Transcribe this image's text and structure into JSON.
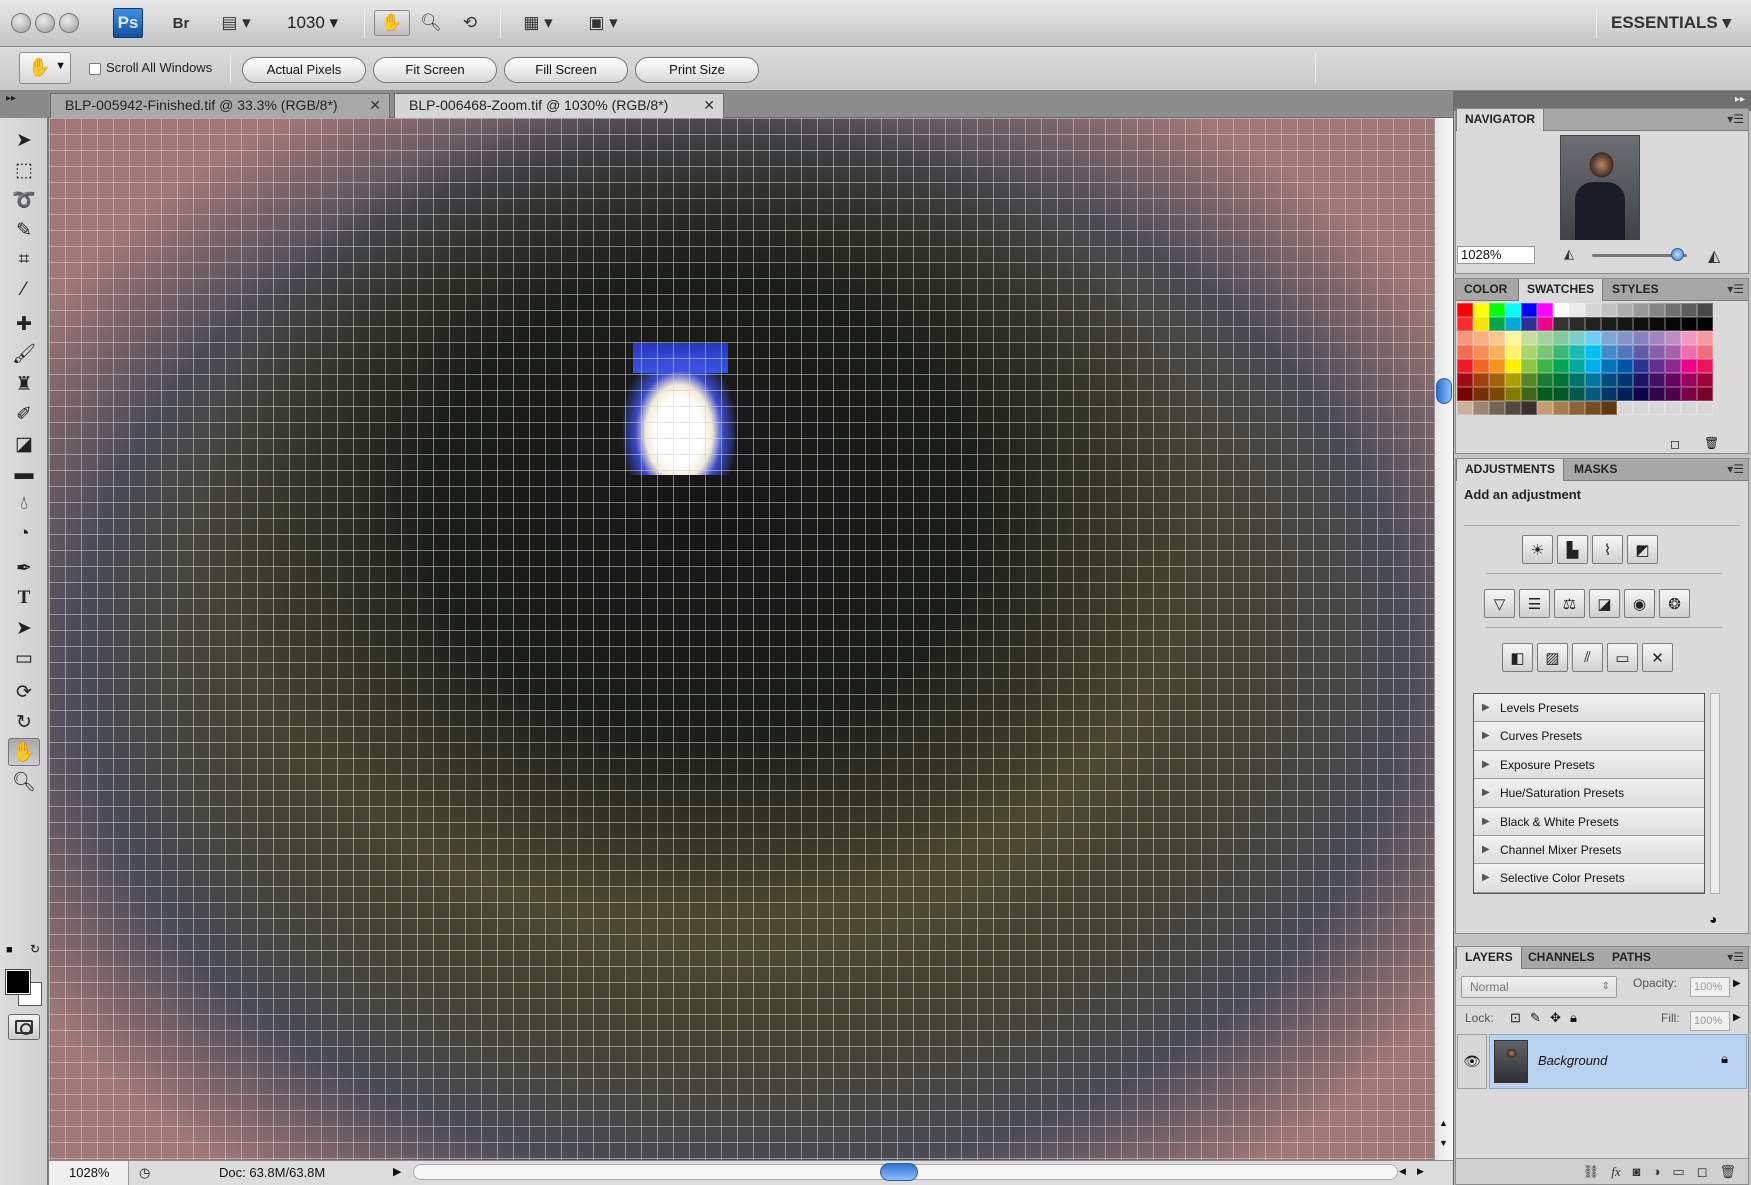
{
  "appbar": {
    "ps_badge": "Ps",
    "bridge_label": "Br",
    "zoom_value": "1030",
    "workspace": "ESSENTIALS ▾",
    "icons": [
      "hand-icon",
      "zoom-icon",
      "rotate-view-icon",
      "arrange-documents-icon",
      "screen-mode-icon"
    ]
  },
  "options": {
    "scroll_all_label": "Scroll All Windows",
    "buttons": [
      "Actual Pixels",
      "Fit Screen",
      "Fill Screen",
      "Print Size"
    ]
  },
  "tabs": [
    {
      "label": "BLP-005942-Finished.tif @ 33.3% (RGB/8*)",
      "active": false
    },
    {
      "label": "BLP-006468-Zoom.tif @ 1030% (RGB/8*)",
      "active": true
    }
  ],
  "status": {
    "zoom": "1028%",
    "doc": "Doc: 63.8M/63.8M"
  },
  "navigator": {
    "tab": "NAVIGATOR",
    "zoom": "1028%"
  },
  "color_panel": {
    "tabs": [
      "COLOR",
      "SWATCHES",
      "STYLES"
    ],
    "active": "SWATCHES"
  },
  "swatches": [
    "#ff0000",
    "#ffff00",
    "#00ff00",
    "#00ffff",
    "#0000ff",
    "#ff00ff",
    "#ffffff",
    "#ebebeb",
    "#d6d6d6",
    "#c2c2c2",
    "#adadad",
    "#999999",
    "#858585",
    "#707070",
    "#5c5c5c",
    "#474747",
    "#ff2a2a",
    "#f6e400",
    "#00a84f",
    "#00a9d6",
    "#2e3192",
    "#ec008c",
    "#333333",
    "#2a2a2a",
    "#222222",
    "#1a1a1a",
    "#141414",
    "#0f0f0f",
    "#0a0a0a",
    "#050505",
    "#030303",
    "#000000",
    "#f7977a",
    "#f9ad81",
    "#fdc68a",
    "#fff79a",
    "#c4df9b",
    "#a2d39c",
    "#82ca9d",
    "#7bcdc8",
    "#6ecff6",
    "#7ea7d8",
    "#8493ca",
    "#8882be",
    "#a187be",
    "#bc8dbf",
    "#f49ac2",
    "#f6989d",
    "#f26c4f",
    "#f68e55",
    "#fbaf5c",
    "#fff467",
    "#acd372",
    "#7cc576",
    "#3bb878",
    "#1abbb4",
    "#00bff3",
    "#438cca",
    "#5574b9",
    "#605ca8",
    "#855fa8",
    "#a763a8",
    "#f06ea9",
    "#f26d7d",
    "#ed1c24",
    "#f26522",
    "#f7941d",
    "#fff200",
    "#8dc73f",
    "#39b54a",
    "#00a651",
    "#00a99d",
    "#00aeef",
    "#0072bc",
    "#0054a6",
    "#2e3192",
    "#662d91",
    "#92278f",
    "#ec008c",
    "#ed145b",
    "#9e0b0f",
    "#a0410d",
    "#a36209",
    "#aba000",
    "#598527",
    "#1a7b30",
    "#007236",
    "#00746b",
    "#0076a3",
    "#004b80",
    "#003471",
    "#1b1464",
    "#440e62",
    "#630460",
    "#9e005d",
    "#9e0039",
    "#790000",
    "#7b2e00",
    "#7d4900",
    "#827b00",
    "#406618",
    "#005e20",
    "#005826",
    "#005952",
    "#005b7f",
    "#003663",
    "#002157",
    "#0d004c",
    "#32004b",
    "#4b0049",
    "#7b0046",
    "#7a0026",
    "#c7b299",
    "#998675",
    "#736357",
    "#534741",
    "#37302d",
    "#c69c6d",
    "#a67c52",
    "#8c6239",
    "#754c24",
    "#603913",
    "#d8d8d8",
    "#d8d8d8",
    "#d8d8d8",
    "#d8d8d8",
    "#d8d8d8",
    "#d8d8d8"
  ],
  "adjustments": {
    "tabs": [
      "ADJUSTMENTS",
      "MASKS"
    ],
    "heading": "Add an adjustment",
    "presets": [
      "Levels Presets",
      "Curves Presets",
      "Exposure Presets",
      "Hue/Saturation Presets",
      "Black & White Presets",
      "Channel Mixer Presets",
      "Selective Color Presets"
    ]
  },
  "layers": {
    "tabs": [
      "LAYERS",
      "CHANNELS",
      "PATHS"
    ],
    "blend": "Normal",
    "opacity_label": "Opacity:",
    "opacity": "100%",
    "lock_label": "Lock:",
    "fill_label": "Fill:",
    "fill": "100%",
    "layer_name": "Background"
  }
}
